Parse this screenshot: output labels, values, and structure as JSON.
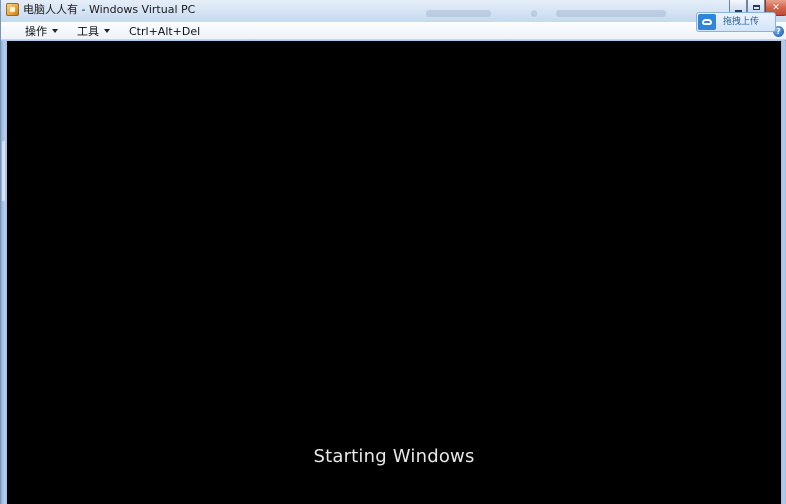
{
  "window": {
    "title": "电脑人人有 - Windows Virtual PC"
  },
  "menubar": {
    "items": [
      {
        "label": "操作",
        "has_dropdown": true
      },
      {
        "label": "工具",
        "has_dropdown": true
      },
      {
        "label": "Ctrl+Alt+Del",
        "has_dropdown": false
      }
    ],
    "help_glyph": "?"
  },
  "upload_widget": {
    "label": "拖拽上传",
    "icon": "cloud-icon"
  },
  "screen": {
    "status_text": "Starting Windows",
    "background": "#000000"
  },
  "colors": {
    "frame": "#a9c4e6",
    "close_button": "#d4664a",
    "upload_accent": "#2f86d9"
  }
}
